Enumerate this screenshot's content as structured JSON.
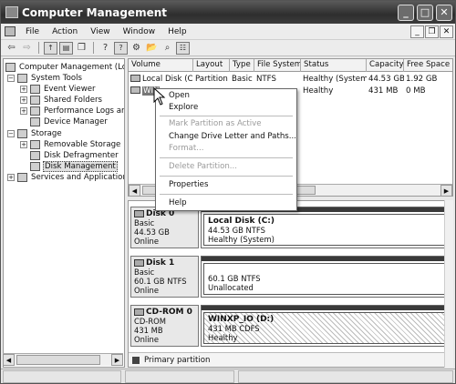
{
  "window": {
    "title": "Computer Management"
  },
  "menubar": {
    "items": [
      "File",
      "Action",
      "View",
      "Window",
      "Help"
    ]
  },
  "toolbar": {
    "icons": [
      "back-icon",
      "forward-icon",
      "up-level-icon",
      "show-hide-tree-icon",
      "properties-icon",
      "help-icon",
      "help-topics-icon",
      "connect-icon",
      "open-icon",
      "search-icon",
      "disk-properties-icon"
    ]
  },
  "tree": {
    "root": "Computer Management (Local)",
    "system_tools": "System Tools",
    "event_viewer": "Event Viewer",
    "shared_folders": "Shared Folders",
    "performance_logs": "Performance Logs and",
    "device_manager": "Device Manager",
    "storage": "Storage",
    "removable_storage": "Removable Storage",
    "disk_defragmenter": "Disk Defragmenter",
    "disk_management": "Disk Management",
    "services_apps": "Services and Applications"
  },
  "volume_list": {
    "columns": [
      "Volume",
      "Layout",
      "Type",
      "File System",
      "Status",
      "Capacity",
      "Free Space"
    ],
    "rows": [
      {
        "volume": "Local Disk (C:)",
        "layout": "Partition",
        "type": "Basic",
        "fs": "NTFS",
        "status": "Healthy (System)",
        "capacity": "44.53 GB",
        "free": "1.92 GB"
      },
      {
        "volume": "WIN",
        "layout": "",
        "type": "",
        "fs": "",
        "status": "Healthy",
        "capacity": "431 MB",
        "free": "0 MB"
      }
    ]
  },
  "context_menu": {
    "open": "Open",
    "explore": "Explore",
    "mark_active": "Mark Partition as Active",
    "change_drive_letter": "Change Drive Letter and Paths...",
    "format": "Format...",
    "delete_partition": "Delete Partition...",
    "properties": "Properties",
    "help": "Help"
  },
  "disks": [
    {
      "name": "Disk 0",
      "kind": "Basic",
      "size": "44.53 GB",
      "state": "Online",
      "partition": {
        "name": "Local Disk  (C:)",
        "detail": "44.53 GB NTFS",
        "status": "Healthy (System)"
      }
    },
    {
      "name": "Disk 1",
      "kind": "Basic",
      "size": "60.1 GB NTFS",
      "state": "Online",
      "partition": {
        "detail": "60.1 GB NTFS",
        "status": "Unallocated"
      }
    },
    {
      "name": "CD-ROM 0",
      "kind": "CD-ROM",
      "size": "431 MB",
      "state": "Online",
      "partition": {
        "name": "WINXP_IO  (D:)",
        "detail": "431 MB CDFS",
        "status": "Healthy"
      }
    }
  ],
  "legend": {
    "primary_partition": "Primary partition"
  },
  "colors": {
    "titlebar": "#3c3c3c",
    "primary_partition": "#444444"
  }
}
